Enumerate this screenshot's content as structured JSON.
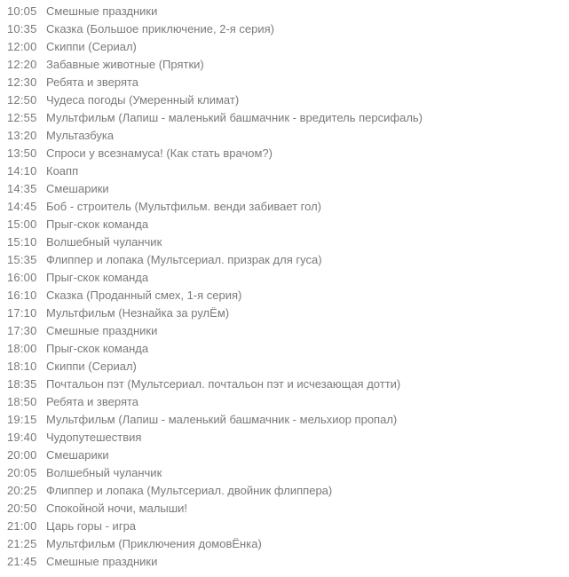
{
  "schedule": [
    {
      "time": "10:05",
      "title": "Смешные праздники",
      "highlight": true,
      "hlw": "w1"
    },
    {
      "time": "10:35",
      "title": "Сказка (Большое приключение, 2-я серия)",
      "highlight": false
    },
    {
      "time": "12:00",
      "title": "Скиппи (Сериал)",
      "highlight": false
    },
    {
      "time": "12:20",
      "title": "Забавные животные (Прятки)",
      "highlight": false
    },
    {
      "time": "12:30",
      "title": "Ребята и зверята",
      "highlight": false
    },
    {
      "time": "12:50",
      "title": "Чудеса погоды (Умеренный климат)",
      "highlight": false
    },
    {
      "time": "12:55",
      "title": "Мультфильм (Лапиш - маленький башмачник - вредитель персифаль)",
      "highlight": false
    },
    {
      "time": "13:20",
      "title": "Мультазбука",
      "highlight": false
    },
    {
      "time": "13:50",
      "title": "Спроси у всезнамуса! (Как стать врачом?)",
      "highlight": false
    },
    {
      "time": "14:10",
      "title": "Коапп",
      "highlight": false
    },
    {
      "time": "14:35",
      "title": "Смешарики",
      "highlight": false
    },
    {
      "time": "14:45",
      "title": "Боб - строитель (Мультфильм. венди забивает гол)",
      "highlight": false
    },
    {
      "time": "15:00",
      "title": "Прыг-скок команда",
      "highlight": false
    },
    {
      "time": "15:10",
      "title": "Волшебный чуланчик",
      "highlight": false
    },
    {
      "time": "15:35",
      "title": "Флиппер и лопака (Мультсериал. призрак для гуса)",
      "highlight": false
    },
    {
      "time": "16:00",
      "title": "Прыг-скок команда",
      "highlight": false
    },
    {
      "time": "16:10",
      "title": "Сказка (Проданный смех, 1-я серия)",
      "highlight": false
    },
    {
      "time": "17:10",
      "title": "Мультфильм (Незнайка за рулЁм)",
      "highlight": false
    },
    {
      "time": "17:30",
      "title": "Смешные праздники",
      "highlight": true,
      "hlw": "w2"
    },
    {
      "time": "18:00",
      "title": "Прыг-скок команда",
      "highlight": false
    },
    {
      "time": "18:10",
      "title": "Скиппи (Сериал)",
      "highlight": false
    },
    {
      "time": "18:35",
      "title": "Почтальон пэт (Мультсериал. почтальон пэт и исчезающая дотти)",
      "highlight": false
    },
    {
      "time": "18:50",
      "title": "Ребята и зверята",
      "highlight": false
    },
    {
      "time": "19:15",
      "title": "Мультфильм (Лапиш - маленький башмачник - мельхиор пропал)",
      "highlight": false
    },
    {
      "time": "19:40",
      "title": "Чудопутешествия",
      "highlight": false
    },
    {
      "time": "20:00",
      "title": "Смешарики",
      "highlight": false
    },
    {
      "time": "20:05",
      "title": "Волшебный чуланчик",
      "highlight": false
    },
    {
      "time": "20:25",
      "title": "Флиппер и лопака (Мультсериал. двойник флиппера)",
      "highlight": false
    },
    {
      "time": "20:50",
      "title": "Спокойной ночи, малыши!",
      "highlight": false
    },
    {
      "time": "21:00",
      "title": "Царь горы - игра",
      "highlight": false
    },
    {
      "time": "21:25",
      "title": "Мультфильм (Приключения домовЁнка)",
      "highlight": false
    },
    {
      "time": "21:45",
      "title": "Смешные праздники",
      "highlight": true,
      "hlw": "w3"
    }
  ]
}
